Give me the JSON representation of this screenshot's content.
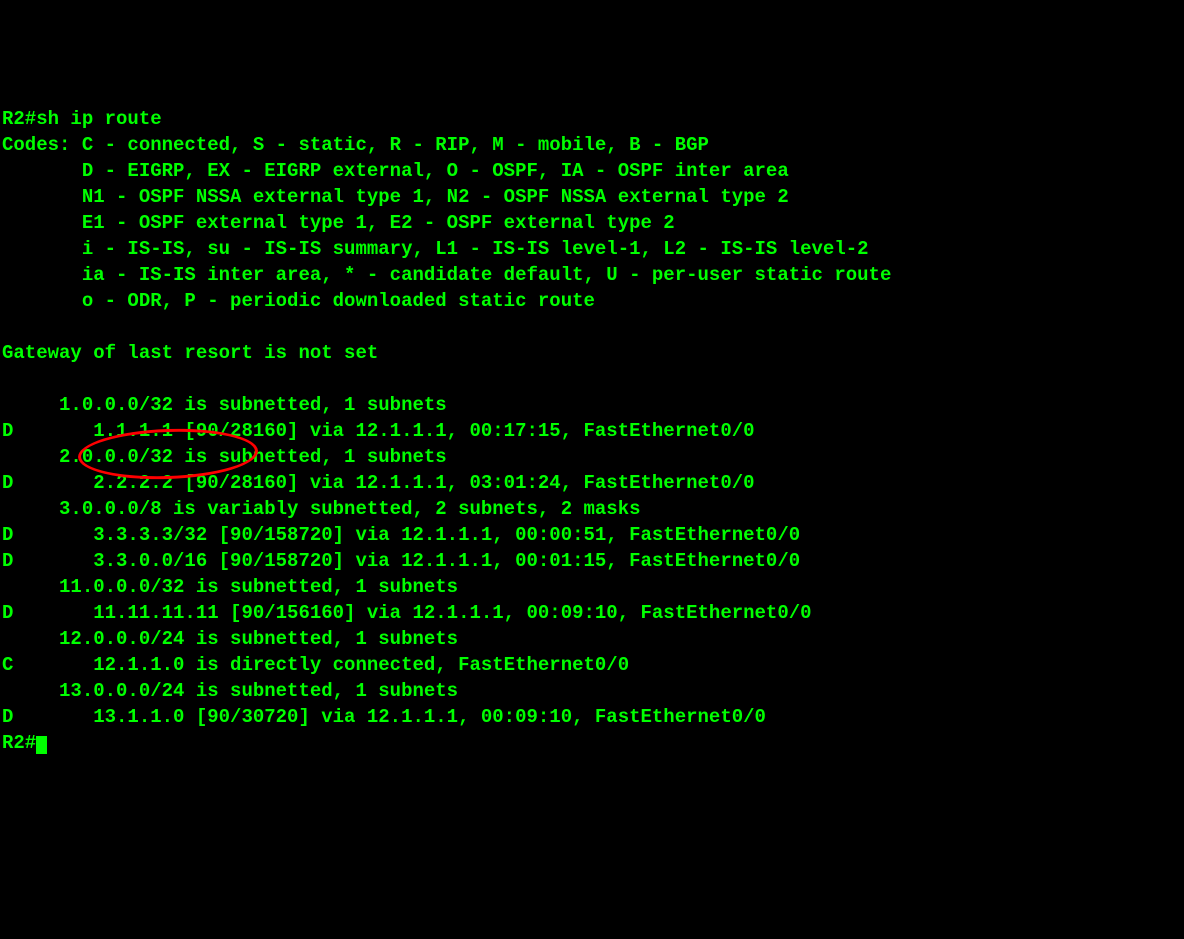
{
  "prompt": "R2#",
  "command": "sh ip route",
  "codes_header": "Codes: C - connected, S - static, R - RIP, M - mobile, B - BGP",
  "codes_line2": "       D - EIGRP, EX - EIGRP external, O - OSPF, IA - OSPF inter area",
  "codes_line3": "       N1 - OSPF NSSA external type 1, N2 - OSPF NSSA external type 2",
  "codes_line4": "       E1 - OSPF external type 1, E2 - OSPF external type 2",
  "codes_line5": "       i - IS-IS, su - IS-IS summary, L1 - IS-IS level-1, L2 - IS-IS level-2",
  "codes_line6": "       ia - IS-IS inter area, * - candidate default, U - per-user static route",
  "codes_line7": "       o - ODR, P - periodic downloaded static route",
  "blank1": "",
  "gateway": "Gateway of last resort is not set",
  "blank2": "",
  "route1": "     1.0.0.0/32 is subnetted, 1 subnets",
  "route2": "D       1.1.1.1 [90/28160] via 12.1.1.1, 00:17:15, FastEthernet0/0",
  "route3": "     2.0.0.0/32 is subnetted, 1 subnets",
  "route4": "D       2.2.2.2 [90/28160] via 12.1.1.1, 03:01:24, FastEthernet0/0",
  "route5": "     3.0.0.0/8 is variably subnetted, 2 subnets, 2 masks",
  "route6": "D       3.3.3.3/32 [90/158720] via 12.1.1.1, 00:00:51, FastEthernet0/0",
  "route7": "D       3.3.0.0/16 [90/158720] via 12.1.1.1, 00:01:15, FastEthernet0/0",
  "route8": "     11.0.0.0/32 is subnetted, 1 subnets",
  "route9": "D       11.11.11.11 [90/156160] via 12.1.1.1, 00:09:10, FastEthernet0/0",
  "route10": "     12.0.0.0/24 is subnetted, 1 subnets",
  "route11": "C       12.1.1.0 is directly connected, FastEthernet0/0",
  "route12": "     13.0.0.0/24 is subnetted, 1 subnets",
  "route13": "D       13.1.1.0 [90/30720] via 12.1.1.1, 00:09:10, FastEthernet0/0",
  "prompt_end": "R2#"
}
